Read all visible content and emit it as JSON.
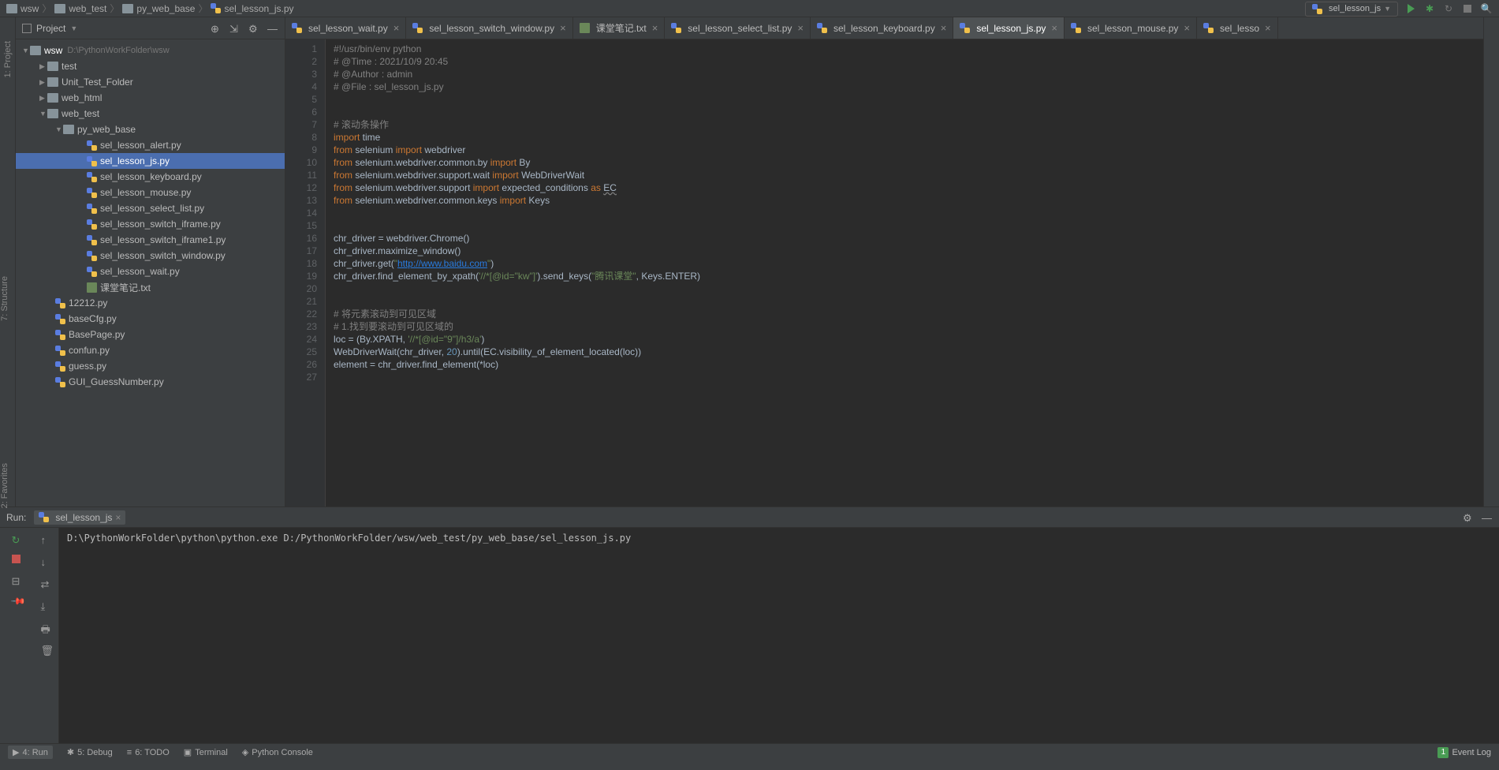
{
  "breadcrumb": [
    "wsw",
    "web_test",
    "py_web_base",
    "sel_lesson_js.py"
  ],
  "run_config": "sel_lesson_js",
  "project_label": "Project",
  "project_root": {
    "name": "wsw",
    "path": "D:\\PythonWorkFolder\\wsw"
  },
  "tree": [
    {
      "label": "test",
      "indent": 1,
      "type": "folder",
      "arrow": "▶"
    },
    {
      "label": "Unit_Test_Folder",
      "indent": 1,
      "type": "folder",
      "arrow": "▶"
    },
    {
      "label": "web_html",
      "indent": 1,
      "type": "folder",
      "arrow": "▶"
    },
    {
      "label": "web_test",
      "indent": 1,
      "type": "folder",
      "arrow": "▼"
    },
    {
      "label": "py_web_base",
      "indent": 2,
      "type": "folder",
      "arrow": "▼"
    },
    {
      "label": "sel_lesson_alert.py",
      "indent": 4,
      "type": "py"
    },
    {
      "label": "sel_lesson_js.py",
      "indent": 4,
      "type": "py",
      "selected": true
    },
    {
      "label": "sel_lesson_keyboard.py",
      "indent": 4,
      "type": "py"
    },
    {
      "label": "sel_lesson_mouse.py",
      "indent": 4,
      "type": "py"
    },
    {
      "label": "sel_lesson_select_list.py",
      "indent": 4,
      "type": "py"
    },
    {
      "label": "sel_lesson_switch_iframe.py",
      "indent": 4,
      "type": "py"
    },
    {
      "label": "sel_lesson_switch_iframe1.py",
      "indent": 4,
      "type": "py"
    },
    {
      "label": "sel_lesson_switch_window.py",
      "indent": 4,
      "type": "py"
    },
    {
      "label": "sel_lesson_wait.py",
      "indent": 4,
      "type": "py"
    },
    {
      "label": "课堂笔记.txt",
      "indent": 4,
      "type": "txt"
    },
    {
      "label": "12212.py",
      "indent": 2,
      "type": "py"
    },
    {
      "label": "baseCfg.py",
      "indent": 2,
      "type": "py"
    },
    {
      "label": "BasePage.py",
      "indent": 2,
      "type": "py"
    },
    {
      "label": "confun.py",
      "indent": 2,
      "type": "py"
    },
    {
      "label": "guess.py",
      "indent": 2,
      "type": "py"
    },
    {
      "label": "GUI_GuessNumber.py",
      "indent": 2,
      "type": "py"
    }
  ],
  "tabs": [
    {
      "label": "sel_lesson_wait.py",
      "icon": "py"
    },
    {
      "label": "sel_lesson_switch_window.py",
      "icon": "py"
    },
    {
      "label": "课堂笔记.txt",
      "icon": "txt"
    },
    {
      "label": "sel_lesson_select_list.py",
      "icon": "py"
    },
    {
      "label": "sel_lesson_keyboard.py",
      "icon": "py"
    },
    {
      "label": "sel_lesson_js.py",
      "icon": "py",
      "active": true
    },
    {
      "label": "sel_lesson_mouse.py",
      "icon": "py"
    },
    {
      "label": "sel_lesso",
      "icon": "py"
    }
  ],
  "code_lines": 27,
  "run_label": "Run:",
  "run_tab": "sel_lesson_js",
  "console_out": "D:\\PythonWorkFolder\\python\\python.exe D:/PythonWorkFolder/wsw/web_test/py_web_base/sel_lesson_js.py",
  "bottom": {
    "run": "4: Run",
    "debug": "5: Debug",
    "todo": "6: TODO",
    "terminal": "Terminal",
    "console": "Python Console",
    "event_log": "Event Log",
    "badge": "1"
  },
  "left_rail": {
    "project": "1: Project",
    "structure": "7: Structure",
    "favorites": "2: Favorites"
  }
}
